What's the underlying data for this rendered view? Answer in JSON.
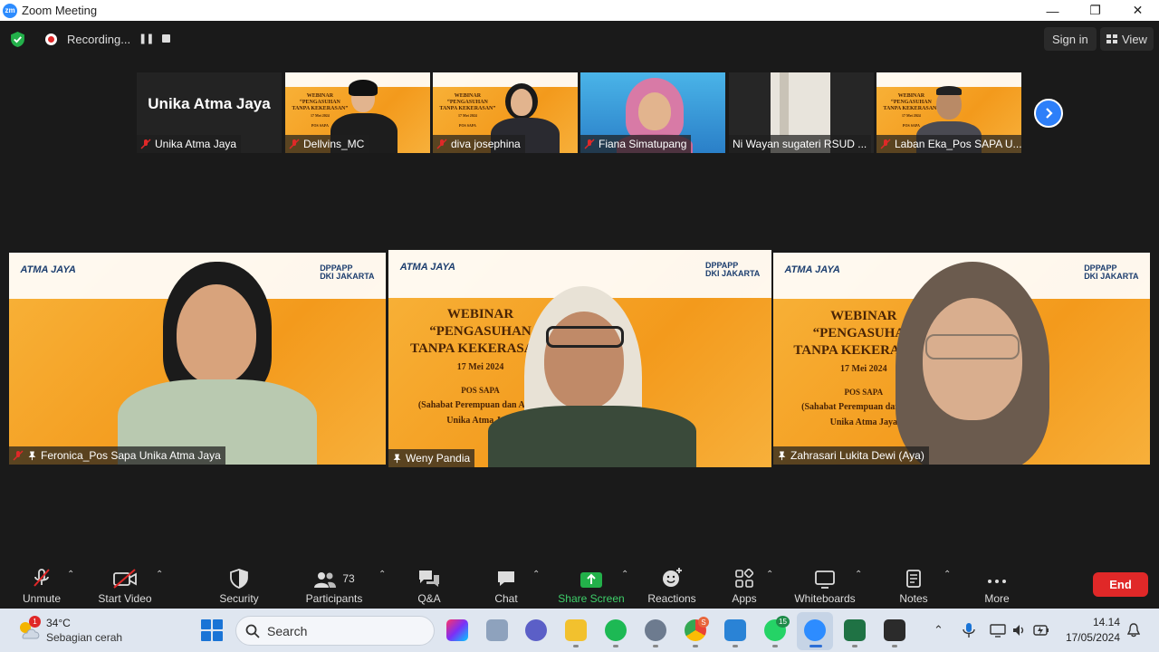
{
  "window": {
    "app_logo": "zm",
    "title": "Zoom Meeting",
    "minimize": "—",
    "maximize": "❐",
    "close": "✕"
  },
  "topbar": {
    "recording_label": "Recording...",
    "sign_in": "Sign in",
    "view": "View"
  },
  "gallery_strip": [
    {
      "name": "Unika Atma Jaya",
      "display": "Unika Atma Jaya",
      "muted": true
    },
    {
      "name": "Dellvins_MC",
      "muted": true
    },
    {
      "name": "diva josephina",
      "muted": true
    },
    {
      "name": "Fiana Simatupang",
      "muted": true
    },
    {
      "name": "Ni Wayan sugateri RSUD ...",
      "muted": false
    },
    {
      "name": "Laban Eka_Pos SAPA U...",
      "muted": true
    }
  ],
  "main_tiles": [
    {
      "name": "Feronica_Pos Sapa Unika Atma Jaya",
      "muted": true,
      "pinned": true
    },
    {
      "name": "Weny Pandia",
      "muted": false,
      "pinned": true,
      "active": true
    },
    {
      "name": "Zahrasari Lukita Dewi (Aya)",
      "muted": false,
      "pinned": true
    }
  ],
  "slide": {
    "logo_left": "ATMA JAYA",
    "logo_right_1": "DPPAPP",
    "logo_right_2": "DKI JAKARTA",
    "title_line1": "WEBINAR",
    "title_line2": "“PENGASUHAN",
    "title_line3": "TANPA KEKERASAN”",
    "date": "17 Mei 2024",
    "org_1": "POS SAPA",
    "org_2": "(Sahabat Perempuan dan Anak)",
    "org_3": "Unika Atma Jaya"
  },
  "toolbar": {
    "unmute": "Unmute",
    "start_video": "Start Video",
    "security": "Security",
    "participants": "Participants",
    "participants_count": "73",
    "qa": "Q&A",
    "chat": "Chat",
    "share_screen": "Share Screen",
    "reactions": "Reactions",
    "apps": "Apps",
    "whiteboards": "Whiteboards",
    "notes": "Notes",
    "more": "More",
    "end": "End"
  },
  "taskbar": {
    "weather_badge": "1",
    "temperature": "34°C",
    "weather": "Sebagian cerah",
    "search": "Search",
    "chrome_badge": "S",
    "whatsapp_badge": "15",
    "time": "14.14",
    "date": "17/05/2024"
  },
  "colors": {
    "accent_blue": "#2d8cff",
    "end_red": "#e02828",
    "share_green": "#3ecf6a",
    "active_speaker": "#e9e97a",
    "slide_orange": "#f5a623"
  }
}
